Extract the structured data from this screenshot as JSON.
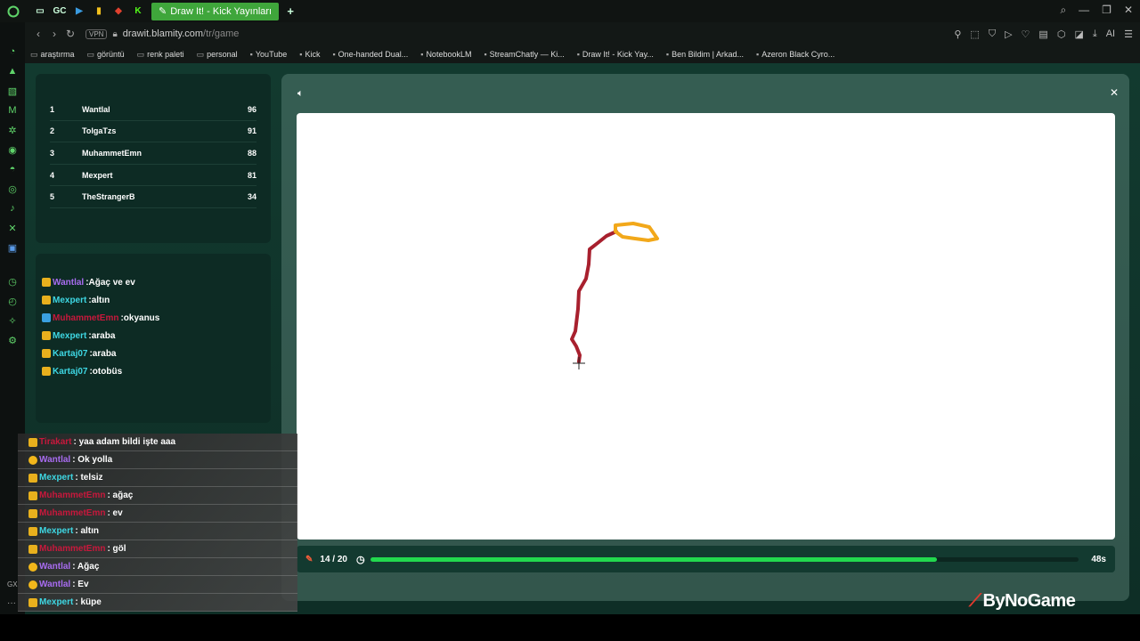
{
  "tabs": {
    "active_title": "Draw It! - Kick Yayınları",
    "small_icons": [
      "opera-icon",
      "gallery-icon",
      "gc-icon",
      "play-icon",
      "bars-icon",
      "diamond-icon",
      "kick-icon"
    ],
    "gc_label": "GC",
    "new_tab": "+"
  },
  "address": {
    "vpn": "VPN",
    "host": "drawit.blamity.com",
    "path": "/tr/game",
    "ai_label": "AI"
  },
  "bookmarks": [
    {
      "icon": "folder-icon",
      "label": "araştırma"
    },
    {
      "icon": "folder-icon",
      "label": "görüntü"
    },
    {
      "icon": "folder-icon",
      "label": "renk paleti"
    },
    {
      "icon": "folder-icon",
      "label": "personal"
    },
    {
      "icon": "page-icon",
      "label": "YouTube"
    },
    {
      "icon": "kick-icon",
      "label": "Kick"
    },
    {
      "icon": "app-icon",
      "label": "One-handed Dual..."
    },
    {
      "icon": "notebook-icon",
      "label": "NotebookLM"
    },
    {
      "icon": "chat-icon",
      "label": "StreamChatly — Ki..."
    },
    {
      "icon": "draw-icon",
      "label": "Draw It! - Kick Yay..."
    },
    {
      "icon": "brain-icon",
      "label": "Ben Bildim | Arkad..."
    },
    {
      "icon": "mouse-icon",
      "label": "Azeron Black Cyro..."
    }
  ],
  "leaderboard": [
    {
      "rank": "1",
      "name": "Wantlal",
      "score": "96"
    },
    {
      "rank": "2",
      "name": "TolgaTzs",
      "score": "91"
    },
    {
      "rank": "3",
      "name": "MuhammetEmn",
      "score": "88"
    },
    {
      "rank": "4",
      "name": "Mexpert",
      "score": "81"
    },
    {
      "rank": "5",
      "name": "TheStrangerB",
      "score": "34"
    }
  ],
  "game_chat": [
    {
      "user": "Wantlal",
      "color": "purple",
      "text": ":Ağaç ve ev"
    },
    {
      "user": "Mexpert",
      "color": "cyan",
      "text": ":altın"
    },
    {
      "user": "MuhammetEmn",
      "color": "red",
      "text": ":okyanus"
    },
    {
      "user": "Mexpert",
      "color": "cyan",
      "text": ":araba"
    },
    {
      "user": "Kartaj07",
      "color": "cyan",
      "text": ":araba"
    },
    {
      "user": "Kartaj07",
      "color": "cyan",
      "text": ":otobüs"
    }
  ],
  "stream_chat": [
    {
      "user": "Tirakart",
      "color": "red",
      "text": ": yaa adam bildi işte aaa"
    },
    {
      "user": "Wantlal",
      "color": "purple",
      "text": ": Ok yolla"
    },
    {
      "user": "Mexpert",
      "color": "cyan",
      "text": ": telsiz"
    },
    {
      "user": "MuhammetEmn",
      "color": "red",
      "text": ": ağaç"
    },
    {
      "user": "MuhammetEmn",
      "color": "red",
      "text": ": ev"
    },
    {
      "user": "Mexpert",
      "color": "cyan",
      "text": ": altın"
    },
    {
      "user": "MuhammetEmn",
      "color": "red",
      "text": ": göl"
    },
    {
      "user": "Wantlal",
      "color": "purple",
      "text": ": Ağaç"
    },
    {
      "user": "Wantlal",
      "color": "purple",
      "text": ": Ev"
    },
    {
      "user": "Mexpert",
      "color": "cyan",
      "text": ": küpe"
    }
  ],
  "game": {
    "round": "14 / 20",
    "time_left": "48s",
    "progress": 0.8
  },
  "colors": {
    "progress_fill": "#22d84e",
    "stroke_red": "#a8202e",
    "stroke_orange": "#f2a81a"
  },
  "logo": "ByNoGame",
  "corner": {
    "gx": "GX",
    "more": "···"
  }
}
